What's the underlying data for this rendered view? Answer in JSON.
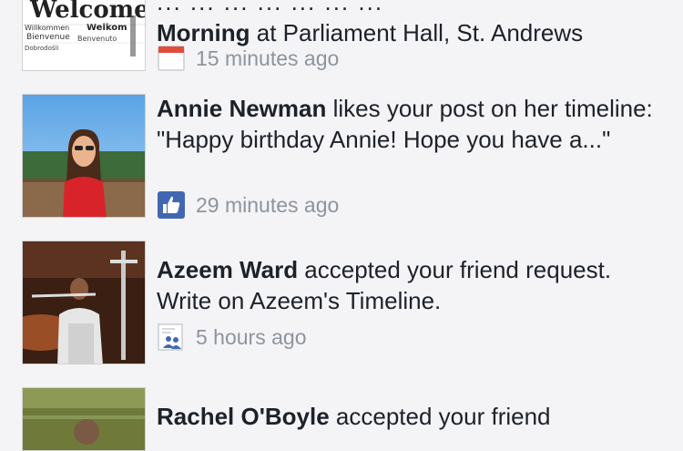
{
  "notifications": [
    {
      "name": "",
      "message_line1": "... ... ... ... ... ... ...",
      "name_prefix": "Morning",
      "message_tail": " at Parliament Hall, St. Andrews",
      "time": "15 minutes ago",
      "icon": "calendar-icon",
      "thumb_text": "Welcome",
      "thumb_words": [
        "Willkommen",
        "Welkom",
        "Bienvenue",
        "Benvenuto",
        "Dobrodošli"
      ]
    },
    {
      "name": "Annie Newman",
      "message": " likes your post on her timeline: \"Happy birthday Annie! Hope you have a...\"",
      "time": "29 minutes ago",
      "icon": "like-icon"
    },
    {
      "name": "Azeem Ward",
      "message": " accepted your friend request. Write on Azeem's Timeline.",
      "time": "5 hours ago",
      "icon": "friends-icon"
    },
    {
      "name": "Rachel O'Boyle",
      "message": " accepted your friend",
      "time": "",
      "icon": "friends-icon"
    }
  ],
  "colors": {
    "background": "#f4f4f6",
    "text": "#1d2129",
    "meta": "#8d949e",
    "like_blue": "#4267b2"
  }
}
